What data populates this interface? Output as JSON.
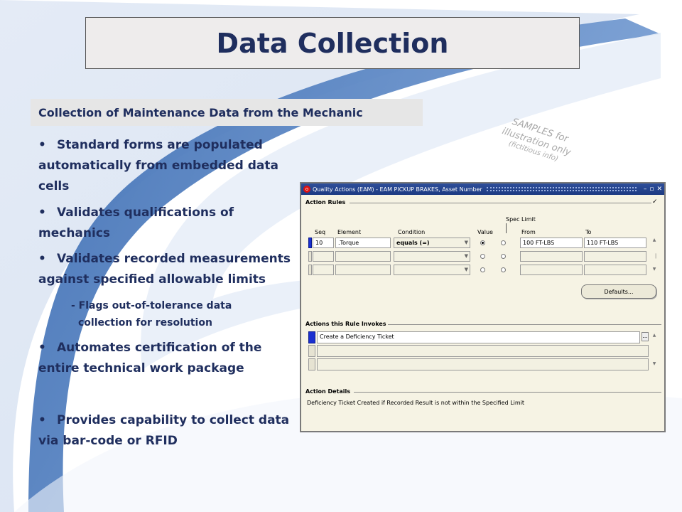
{
  "slide": {
    "title": "Data Collection",
    "subtitle": "Collection of Maintenance Data from the Mechanic",
    "bullets": [
      {
        "line1": "Standard forms are populated",
        "line2": "automatically from embedded data",
        "line3": "cells"
      },
      {
        "line1": "Validates qualifications of",
        "line2": "mechanics"
      },
      {
        "line1": "Validates recorded measurements",
        "line2": "against specified allowable limits"
      },
      {
        "line1": "Automates certification of the",
        "line2": "entire technical work package"
      },
      {
        "line1": "Provides capability to collect data",
        "line2": "via bar-code or RFID"
      }
    ],
    "sub_bullet": {
      "line1": "- Flags out-of-tolerance  data",
      "line2": "collection for resolution"
    },
    "watermark": {
      "line1": "SAMPLES for",
      "line2": "illustration only",
      "line3": "(fictitious info)"
    },
    "colors": {
      "heading": "#1f2e5e",
      "swoosh": "#5b86c5",
      "titlebar": "#1c3a82"
    }
  },
  "form": {
    "window_title": "Quality Actions (EAM) - EAM PICKUP BRAKES, Asset Number",
    "window_controls": [
      "minimize-icon",
      "maximize-icon",
      "close-icon"
    ],
    "action_rules": {
      "section_label": "Action Rules",
      "columns": {
        "seq": "Seq",
        "element": "Element",
        "condition": "Condition",
        "value": "Value",
        "spec_limit": "Spec Limit",
        "from": "From",
        "to": "To"
      },
      "rows": [
        {
          "seq": "10",
          "element": ".Torque",
          "condition": "equals (=)",
          "value_selected": "first",
          "from": "100 FT-LBS",
          "to": "110 FT-LBS"
        },
        {
          "seq": "",
          "element": "",
          "condition": "",
          "value_selected": "none",
          "from": "",
          "to": ""
        },
        {
          "seq": "",
          "element": "",
          "condition": "",
          "value_selected": "none",
          "from": "",
          "to": ""
        }
      ],
      "defaults_button": "Defaults..."
    },
    "actions_invoked": {
      "section_label": "Actions this Rule Invokes",
      "rows": [
        "Create a Deficiency Ticket",
        "",
        ""
      ],
      "ellipsis": "..."
    },
    "action_details": {
      "section_label": "Action Details",
      "text": "Deficiency Ticket Created if Recorded Result is not within the Specified Limit"
    }
  }
}
